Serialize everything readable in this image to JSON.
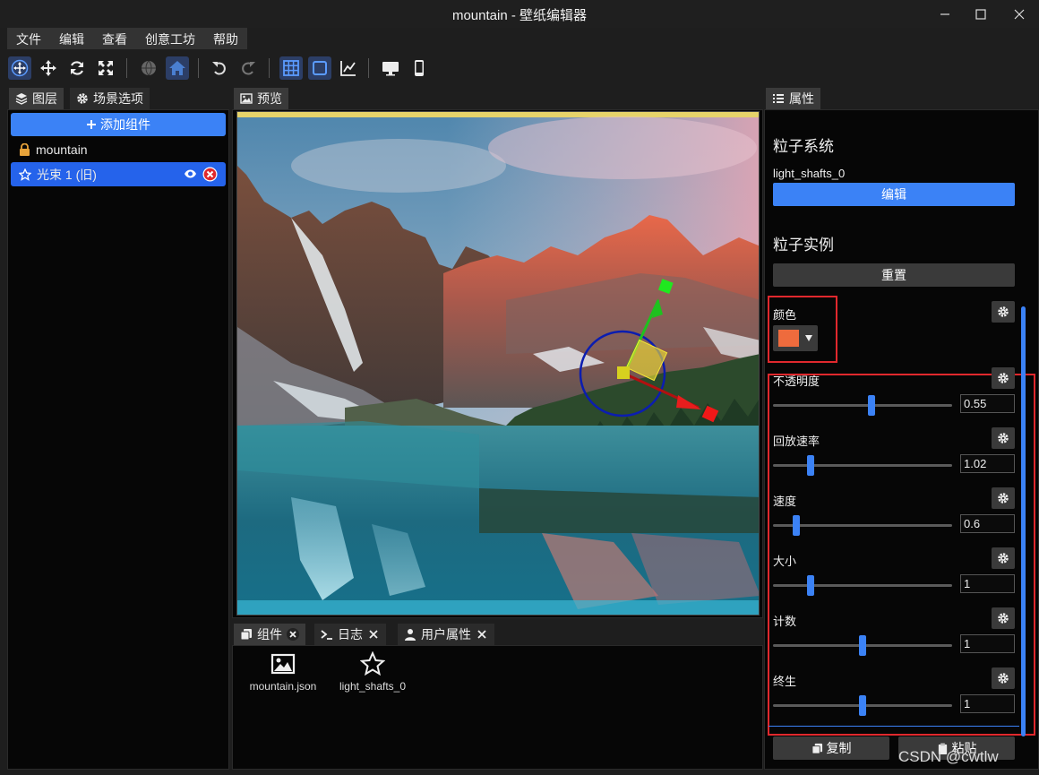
{
  "window": {
    "title": "mountain - 壁纸编辑器"
  },
  "menu": [
    "文件",
    "编辑",
    "查看",
    "创意工坊",
    "帮助"
  ],
  "toolbar": {
    "icons": [
      "move-gizmo-icon",
      "translate-icon",
      "rotate-icon",
      "scale-icon",
      "globe-icon",
      "home-icon",
      "undo-icon",
      "redo-icon",
      "grid-icon",
      "square-icon",
      "chart-icon",
      "desktop-icon",
      "phone-icon"
    ]
  },
  "left_panel": {
    "tabs": [
      "图层",
      "场景选项"
    ],
    "add_button": "添加组件",
    "layers": [
      {
        "label": "mountain",
        "locked": true
      },
      {
        "label": "光束 1 (旧)",
        "selected": true
      }
    ]
  },
  "preview": {
    "tab": "预览"
  },
  "bottom_panel": {
    "tabs": [
      "组件",
      "日志",
      "用户属性"
    ],
    "items": [
      {
        "label": "mountain.json",
        "icon": "image-icon"
      },
      {
        "label": "light_shafts_0",
        "icon": "star-icon"
      }
    ]
  },
  "properties": {
    "tab": "属性",
    "section1": "粒子系统",
    "system_name": "light_shafts_0",
    "edit_button": "编辑",
    "section2": "粒子实例",
    "reset_button": "重置",
    "color_label": "颜色",
    "color_value": "#ee6b3d",
    "sliders": [
      {
        "label": "不透明度",
        "value": "0.55",
        "position": 0.55
      },
      {
        "label": "回放速率",
        "value": "1.02",
        "position": 0.21
      },
      {
        "label": "速度",
        "value": "0.6",
        "position": 0.13
      },
      {
        "label": "大小",
        "value": "1",
        "position": 0.21
      },
      {
        "label": "计数",
        "value": "1",
        "position": 0.5
      },
      {
        "label": "终生",
        "value": "1",
        "position": 0.5
      }
    ],
    "copy_button": "复制",
    "paste_button": "粘贴"
  },
  "watermark": "CSDN @cwtlw"
}
